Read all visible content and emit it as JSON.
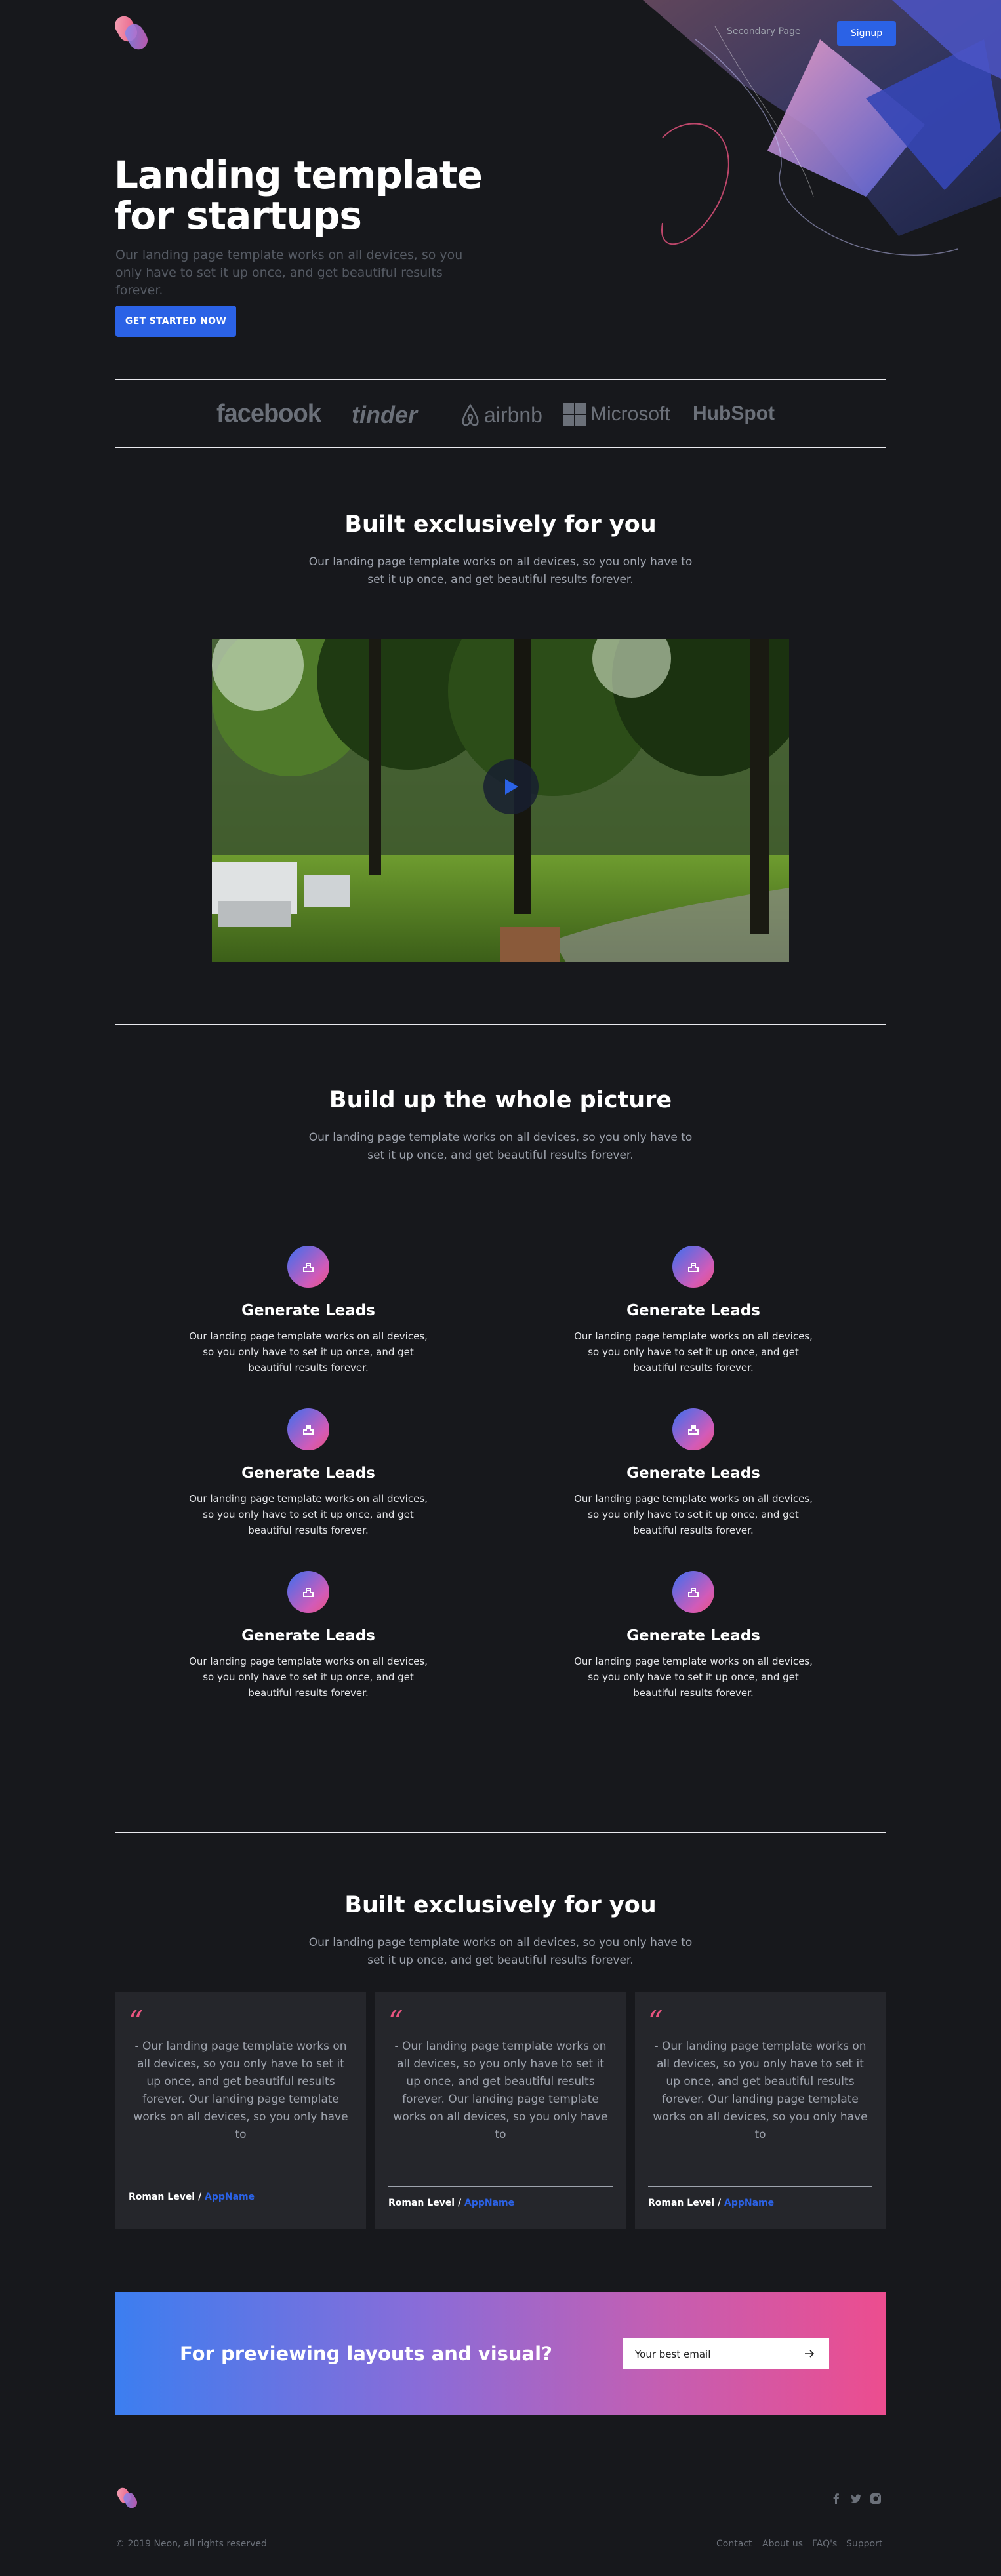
{
  "header": {
    "nav_link": "Secondary Page",
    "signup": "Signup"
  },
  "hero": {
    "title_line1": "Landing template",
    "title_line2": "for startups",
    "subtitle": "Our landing page template works on all devices, so you only have to set it up once, and get beautiful results forever.",
    "cta": "GET STARTED NOW"
  },
  "clients": [
    "facebook",
    "tinder",
    "airbnb",
    "Microsoft",
    "HubSpot"
  ],
  "section_video": {
    "title": "Built exclusively for you",
    "subtitle": "Our landing page template works on all devices, so you only have to set it up once, and get beautiful results forever."
  },
  "section_features": {
    "title": "Build up the whole picture",
    "subtitle": "Our landing page template works on all devices, so you only have to set it up once, and get beautiful results forever.",
    "items": [
      {
        "title": "Generate Leads",
        "text": "Our landing page template works on all devices, so you only have to set it up once, and get beautiful results forever."
      },
      {
        "title": "Generate Leads",
        "text": "Our landing page template works on all devices, so you only have to set it up once, and get beautiful results forever."
      },
      {
        "title": "Generate Leads",
        "text": "Our landing page template works on all devices, so you only have to set it up once, and get beautiful results forever."
      },
      {
        "title": "Generate Leads",
        "text": "Our landing page template works on all devices, so you only have to set it up once, and get beautiful results forever."
      },
      {
        "title": "Generate Leads",
        "text": "Our landing page template works on all devices, so you only have to set it up once, and get beautiful results forever."
      },
      {
        "title": "Generate Leads",
        "text": "Our landing page template works on all devices, so you only have to set it up once, and get beautiful results forever."
      }
    ]
  },
  "section_testimonials": {
    "title": "Built exclusively for you",
    "subtitle": "Our landing page template works on all devices, so you only have to set it up once, and get beautiful results forever.",
    "items": [
      {
        "quote": "- Our landing page template works on all devices, so you only have to set it up once, and get beautiful results forever. Our landing page template works on all devices, so you only have to",
        "author": "Roman Level",
        "sep": " / ",
        "app": "AppName"
      },
      {
        "quote": "- Our landing page template works on all devices, so you only have to set it up once, and get beautiful results forever. Our landing page template works on all devices, so you only have to",
        "author": "Roman Level",
        "sep": " / ",
        "app": "AppName"
      },
      {
        "quote": "- Our landing page template works on all devices, so you only have to set it up once, and get beautiful results forever. Our landing page template works on all devices, so you only have to",
        "author": "Roman Level",
        "sep": " / ",
        "app": "AppName"
      }
    ]
  },
  "cta_banner": {
    "title": "For previewing layouts and visual?",
    "email_placeholder": "Your best email"
  },
  "footer": {
    "copyright": "© 2019 Neon, all rights reserved",
    "links": [
      "Contact",
      "About us",
      "FAQ's",
      "Support"
    ],
    "social_icons": [
      "facebook-icon",
      "twitter-icon",
      "instagram-icon"
    ]
  },
  "colors": {
    "background": "#17181c",
    "accent": "#2b62e6",
    "pink": "#e9547f",
    "card": "#25262b"
  }
}
